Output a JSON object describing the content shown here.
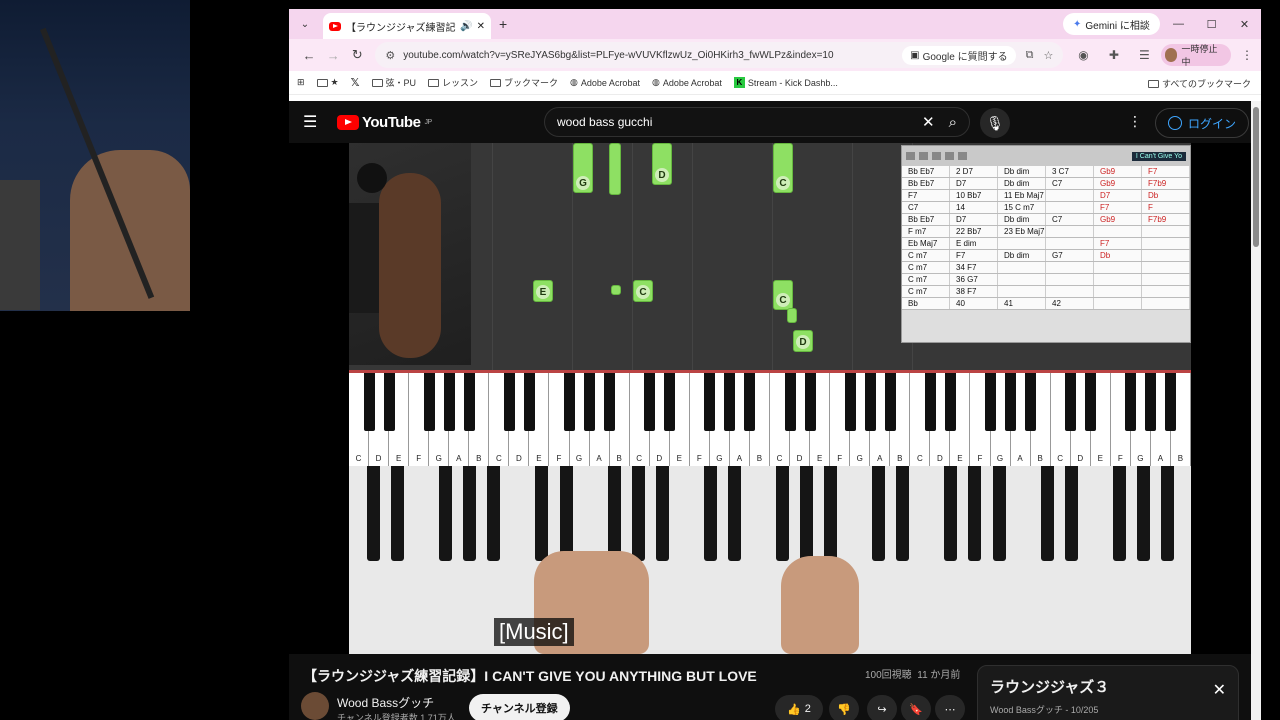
{
  "browser": {
    "tab_title": "【ラウンジジャズ練習記録】I CA",
    "gemini_label": "Gemini に相談",
    "url": "youtube.com/watch?v=ySReJYAS6bg&list=PLFye-wVUVKflzwUz_Oi0HKirh3_fwWLPz&index=10",
    "google_ask": "Google に質問する",
    "profile_label": "一時停止中",
    "bookmarks": [
      "弦・PU",
      "レッスン",
      "ブックマーク",
      "Adobe Acrobat",
      "Adobe Acrobat",
      "Stream - Kick Dashb..."
    ],
    "all_bookmarks": "すべてのブックマーク"
  },
  "youtube": {
    "logo_text": "YouTube",
    "logo_region": "JP",
    "search_query": "wood bass gucchi",
    "login_label": "ログイン",
    "caption": "[Music]",
    "video_title": "【ラウンジジャズ練習記録】I CAN'T GIVE YOU ANYTHING BUT LOVE",
    "views": "100回視聴",
    "age": "11 か月前",
    "channel_name": "Wood Bassグッチ",
    "subscribers": "チャンネル登録者数 1.71万人",
    "subscribe_label": "チャンネル登録",
    "like_count": "2",
    "playlist_title": "ラウンジジャズ３",
    "playlist_sub": "Wood Bassグッチ - 10/205"
  },
  "video_overlay": {
    "notes": [
      "G",
      "D",
      "C",
      "E",
      "C",
      "C",
      "D"
    ],
    "chart_title": "I Can't Give Yo",
    "chord_rows": [
      [
        "Bb Eb7",
        "2 D7",
        "Db dim",
        "3 C7",
        "Gb9",
        "F7"
      ],
      [
        "Bb Eb7",
        "D7",
        "Db dim",
        "C7",
        "Gb9",
        "F7b9"
      ],
      [
        "F7",
        "10 Bb7",
        "11 Eb Maj7",
        "",
        "D7",
        "Db"
      ],
      [
        "C7",
        "14",
        "15 C m7",
        "",
        "F7",
        "F"
      ],
      [
        "Bb Eb7",
        "D7",
        "Db dim",
        "C7",
        "Gb9",
        "F7b9"
      ],
      [
        "F m7",
        "22 Bb7",
        "23 Eb Maj7",
        "",
        "",
        ""
      ],
      [
        "Eb Maj7",
        "E dim",
        "",
        "",
        "F7",
        ""
      ],
      [
        "C m7",
        "F7",
        "Db dim",
        "G7",
        "Db",
        ""
      ],
      [
        "C m7",
        "34 F7",
        "",
        "",
        "",
        ""
      ],
      [
        "C m7",
        "36 G7",
        "",
        "",
        "",
        ""
      ],
      [
        "C m7",
        "38 F7",
        "",
        "",
        "",
        ""
      ],
      [
        "Bb",
        "40",
        "41",
        "42",
        "",
        ""
      ]
    ],
    "white_keys": [
      "C",
      "D",
      "E",
      "F",
      "G",
      "A",
      "B",
      "C",
      "D",
      "E",
      "F",
      "G",
      "A",
      "B",
      "C",
      "D",
      "E",
      "F",
      "G",
      "A",
      "B",
      "C",
      "D",
      "E",
      "F",
      "G",
      "A",
      "B",
      "C",
      "D",
      "E",
      "F",
      "G",
      "A",
      "B",
      "C",
      "D",
      "E",
      "F",
      "G",
      "A",
      "B"
    ]
  }
}
